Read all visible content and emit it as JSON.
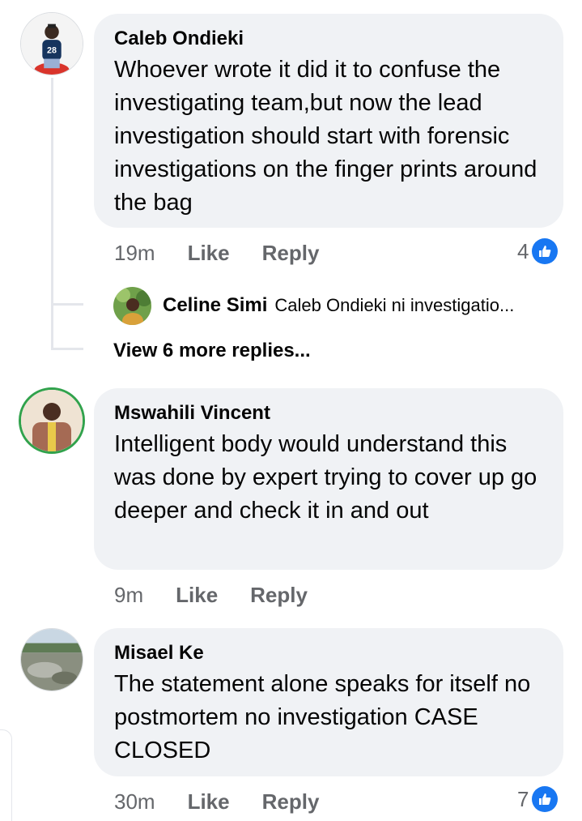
{
  "comments": [
    {
      "author": "Caleb Ondieki",
      "text": "Whoever wrote it did it to confuse the investigating team,but now the lead investigation should start with forensic investigations on the finger prints around the bag",
      "time": "19m",
      "like_label": "Like",
      "reply_label": "Reply",
      "reaction_count": "4",
      "jersey_number": "28",
      "reply_preview": {
        "author": "Celine Simi",
        "text": "Caleb Ondieki ni investigatio..."
      },
      "view_more_label": "View 6 more replies..."
    },
    {
      "author": "Mswahili Vincent",
      "text": "Intelligent body would understand this was done by expert trying to cover up go deeper and check it in and out",
      "time": "9m",
      "like_label": "Like",
      "reply_label": "Reply"
    },
    {
      "author": "Misael Ke",
      "text": "The statement alone speaks for itself no postmortem no investigation CASE CLOSED",
      "time": "30m",
      "like_label": "Like",
      "reply_label": "Reply",
      "reaction_count": "7"
    }
  ],
  "colors": {
    "bubble": "#f0f2f5",
    "secondary_text": "#65676b",
    "like_blue": "#1877f2",
    "thread_line": "#e4e6eb",
    "active_ring": "#31a24c"
  },
  "icons": {
    "reaction": "thumbs-up-icon"
  }
}
